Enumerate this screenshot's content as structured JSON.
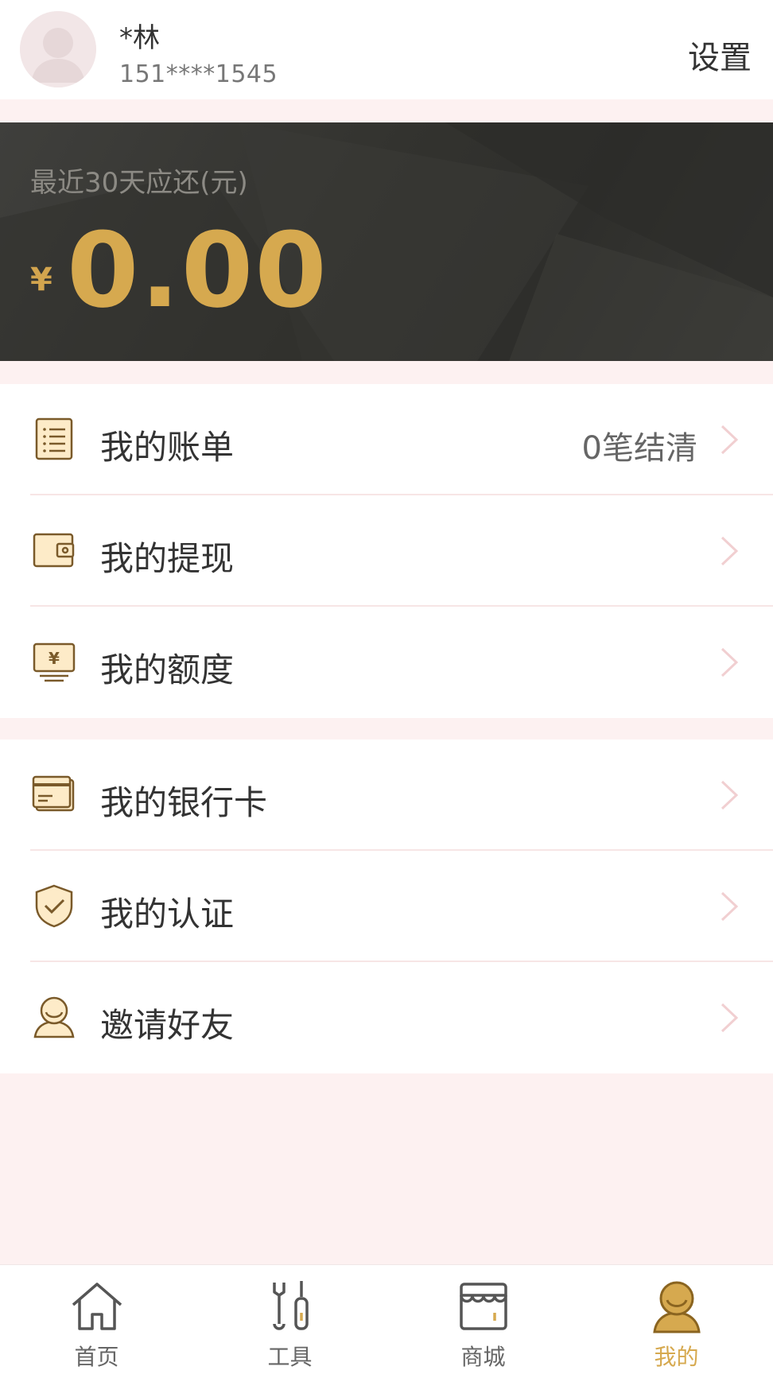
{
  "header": {
    "username": "*林",
    "phone": "151****1545",
    "settings_label": "设置"
  },
  "repay": {
    "label": "最近30天应还(元)",
    "currency": "¥",
    "amount": "0.00"
  },
  "menu_group_1": [
    {
      "label": "我的账单",
      "right_text": "0笔结清",
      "icon": "bill-icon"
    },
    {
      "label": "我的提现",
      "right_text": "",
      "icon": "wallet-icon"
    },
    {
      "label": "我的额度",
      "right_text": "",
      "icon": "credit-limit-icon"
    }
  ],
  "menu_group_2": [
    {
      "label": "我的银行卡",
      "right_text": "",
      "icon": "bank-card-icon"
    },
    {
      "label": "我的认证",
      "right_text": "",
      "icon": "shield-check-icon"
    },
    {
      "label": "邀请好友",
      "right_text": "",
      "icon": "invite-user-icon"
    }
  ],
  "tabbar": [
    {
      "label": "首页",
      "icon": "home-icon",
      "active": false
    },
    {
      "label": "工具",
      "icon": "tools-icon",
      "active": false
    },
    {
      "label": "商城",
      "icon": "store-icon",
      "active": false
    },
    {
      "label": "我的",
      "icon": "profile-icon",
      "active": true
    }
  ],
  "colors": {
    "accent": "#d6a94f",
    "icon_fill": "#fdebc8",
    "icon_stroke": "#7a5a2a",
    "card_bg": "#33332f",
    "page_bg": "#fdf1f1"
  }
}
